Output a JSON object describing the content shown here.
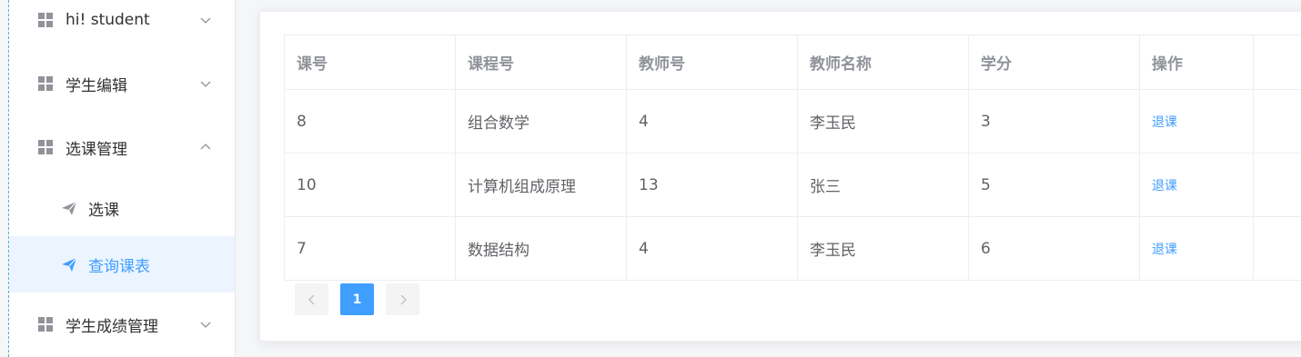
{
  "sidebar": {
    "items": [
      {
        "label": "hi! student",
        "icon": "grid-icon",
        "chevron": "chevron-down-icon"
      },
      {
        "label": "学生编辑",
        "icon": "grid-icon",
        "chevron": "chevron-down-icon"
      },
      {
        "label": "选课管理",
        "icon": "grid-icon",
        "chevron": "chevron-up-icon"
      },
      {
        "label": "学生成绩管理",
        "icon": "grid-icon",
        "chevron": "chevron-down-icon"
      }
    ],
    "sub_items": [
      {
        "label": "选课",
        "icon": "paper-plane-icon",
        "active": false
      },
      {
        "label": "查询课表",
        "icon": "paper-plane-icon",
        "active": true
      }
    ]
  },
  "table": {
    "headers": [
      "课号",
      "课程号",
      "教师号",
      "教师名称",
      "学分",
      "操作"
    ],
    "rows": [
      {
        "course_id": "8",
        "course_name": "组合数学",
        "teacher_id": "4",
        "teacher_name": "李玉民",
        "credit": "3",
        "action": "退课"
      },
      {
        "course_id": "10",
        "course_name": "计算机组成原理",
        "teacher_id": "13",
        "teacher_name": "张三",
        "credit": "5",
        "action": "退课"
      },
      {
        "course_id": "7",
        "course_name": "数据结构",
        "teacher_id": "4",
        "teacher_name": "李玉民",
        "credit": "6",
        "action": "退课"
      }
    ]
  },
  "pagination": {
    "current_page": "1"
  },
  "colors": {
    "accent": "#409eff",
    "active_bg": "#ecf5ff",
    "header_text": "#909399",
    "body_text": "#606266"
  }
}
